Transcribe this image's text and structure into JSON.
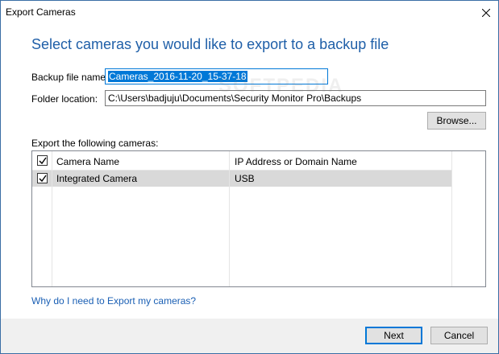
{
  "window": {
    "title": "Export Cameras"
  },
  "heading": "Select cameras you would like to export to a backup file",
  "form": {
    "backup_label": "Backup file name:",
    "backup_value": "Cameras_2016-11-20_15-37-18",
    "folder_label": "Folder location:",
    "folder_value": "C:\\Users\\badjuju\\Documents\\Security Monitor Pro\\Backups",
    "browse_label": "Browse..."
  },
  "export_label": "Export the following cameras:",
  "table": {
    "columns": [
      "Camera Name",
      "IP Address or Domain Name"
    ],
    "header_checked": true,
    "rows": [
      {
        "checked": true,
        "name": "Integrated Camera",
        "address": "USB"
      }
    ]
  },
  "help_link": "Why do I need to Export my cameras?",
  "buttons": {
    "next": "Next",
    "cancel": "Cancel"
  },
  "watermark": "SOFTPEDIA",
  "colors": {
    "accent": "#0078d7",
    "heading": "#1f5fa8",
    "link": "#1a5fb4",
    "selected_row": "#d9d9d9"
  }
}
